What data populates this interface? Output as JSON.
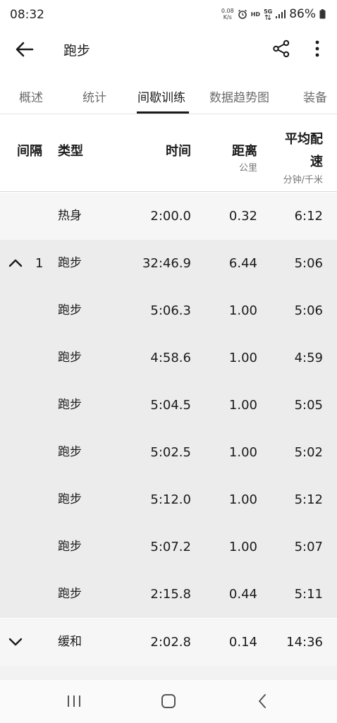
{
  "status_bar": {
    "time": "08:32",
    "net_speed_value": "0.08",
    "net_speed_unit": "K/s",
    "hd_label": "HD",
    "network_label": "5G",
    "battery": "86%"
  },
  "app_bar": {
    "title": "跑步"
  },
  "tabs": [
    {
      "label": "概述",
      "active": false
    },
    {
      "label": "统计",
      "active": false
    },
    {
      "label": "间歇训练",
      "active": true
    },
    {
      "label": "数据趋势图",
      "active": false
    },
    {
      "label": "装备",
      "active": false
    }
  ],
  "table_header": {
    "interval": "间隔",
    "type": "类型",
    "time": "时间",
    "distance": "距离",
    "distance_unit": "公里",
    "pace_line1": "平均配",
    "pace_line2": "速",
    "pace_unit": "分钟/千米"
  },
  "rows": [
    {
      "chevron": "",
      "index": "",
      "type": "热身",
      "time": "2:00.0",
      "distance": "0.32",
      "pace": "6:12"
    },
    {
      "chevron": "up",
      "index": "1",
      "type": "跑步",
      "time": "32:46.9",
      "distance": "6.44",
      "pace": "5:06"
    },
    {
      "chevron": "",
      "index": "",
      "type": "跑步",
      "time": "5:06.3",
      "distance": "1.00",
      "pace": "5:06"
    },
    {
      "chevron": "",
      "index": "",
      "type": "跑步",
      "time": "4:58.6",
      "distance": "1.00",
      "pace": "4:59"
    },
    {
      "chevron": "",
      "index": "",
      "type": "跑步",
      "time": "5:04.5",
      "distance": "1.00",
      "pace": "5:05"
    },
    {
      "chevron": "",
      "index": "",
      "type": "跑步",
      "time": "5:02.5",
      "distance": "1.00",
      "pace": "5:02"
    },
    {
      "chevron": "",
      "index": "",
      "type": "跑步",
      "time": "5:12.0",
      "distance": "1.00",
      "pace": "5:12"
    },
    {
      "chevron": "",
      "index": "",
      "type": "跑步",
      "time": "5:07.2",
      "distance": "1.00",
      "pace": "5:07"
    },
    {
      "chevron": "",
      "index": "",
      "type": "跑步",
      "time": "2:15.8",
      "distance": "0.44",
      "pace": "5:11"
    },
    {
      "chevron": "down",
      "index": "",
      "type": "缓和",
      "time": "2:02.8",
      "distance": "0.14",
      "pace": "14:36"
    }
  ]
}
